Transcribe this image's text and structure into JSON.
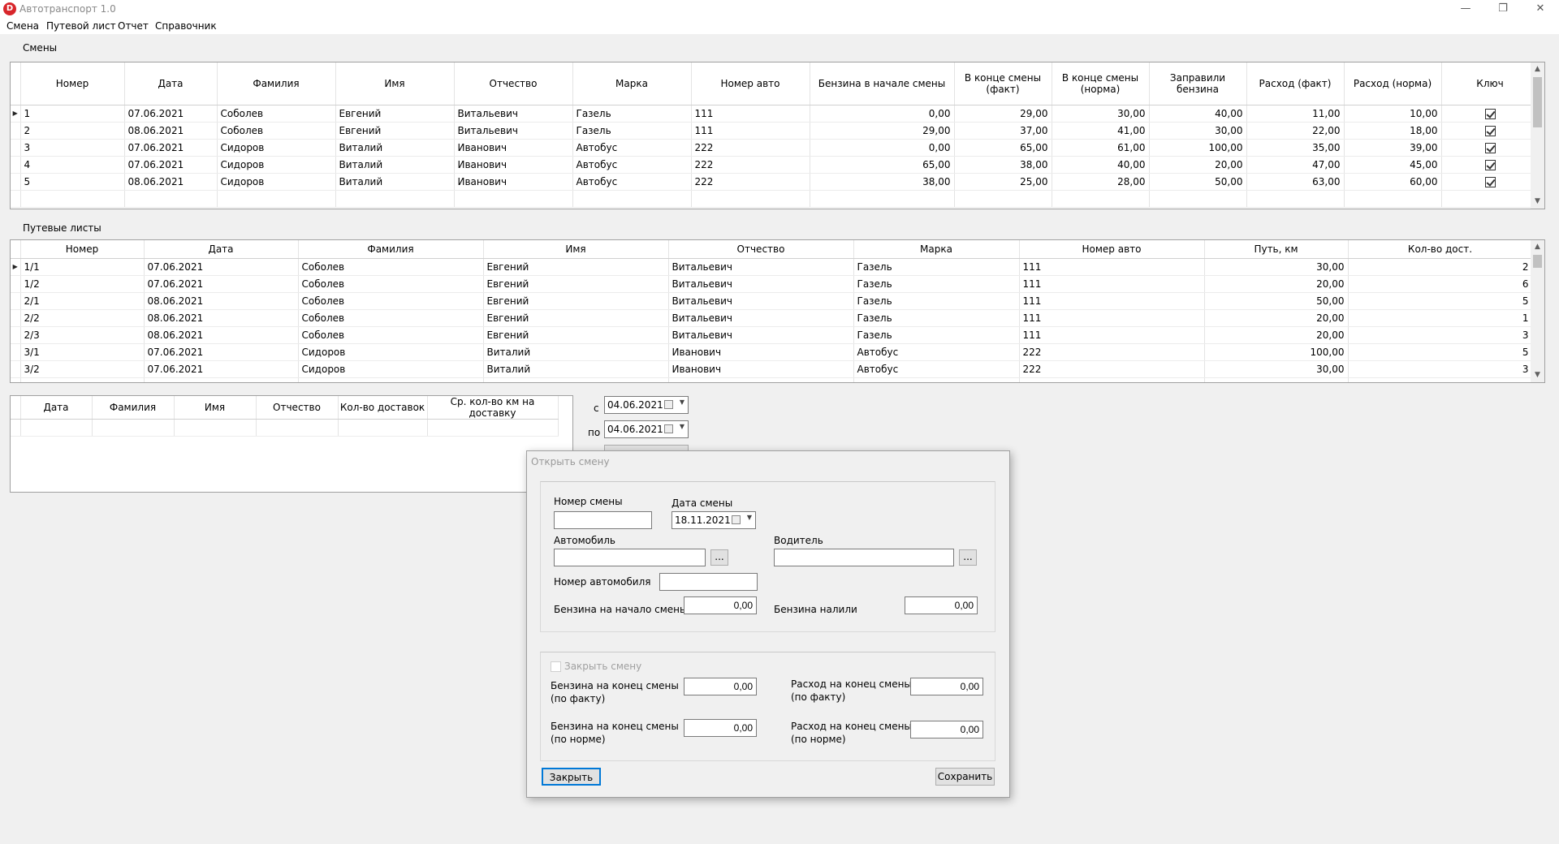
{
  "app": {
    "title": "Автотранспорт 1.0",
    "icon": "app-logo-icon"
  },
  "menu": [
    "Смена",
    "Путевой лист",
    "Отчет",
    "Справочник"
  ],
  "shifts": {
    "label": "Смены",
    "columns": [
      "Номер",
      "Дата",
      "Фамилия",
      "Имя",
      "Отчество",
      "Марка",
      "Номер авто",
      "Бензина в начале смены",
      "В конце смены (факт)",
      "В конце смены (норма)",
      "Заправили бензина",
      "Расход (факт)",
      "Расход (норма)",
      "Ключ"
    ],
    "rows": [
      [
        "1",
        "07.06.2021",
        "Соболев",
        "Евгений",
        "Витальевич",
        "Газель",
        "111",
        "0,00",
        "29,00",
        "30,00",
        "40,00",
        "11,00",
        "10,00"
      ],
      [
        "2",
        "08.06.2021",
        "Соболев",
        "Евгений",
        "Витальевич",
        "Газель",
        "111",
        "29,00",
        "37,00",
        "41,00",
        "30,00",
        "22,00",
        "18,00"
      ],
      [
        "3",
        "07.06.2021",
        "Сидоров",
        "Виталий",
        "Иванович",
        "Автобус",
        "222",
        "0,00",
        "65,00",
        "61,00",
        "100,00",
        "35,00",
        "39,00"
      ],
      [
        "4",
        "07.06.2021",
        "Сидоров",
        "Виталий",
        "Иванович",
        "Автобус",
        "222",
        "65,00",
        "38,00",
        "40,00",
        "20,00",
        "47,00",
        "45,00"
      ],
      [
        "5",
        "08.06.2021",
        "Сидоров",
        "Виталий",
        "Иванович",
        "Автобус",
        "222",
        "38,00",
        "25,00",
        "28,00",
        "50,00",
        "63,00",
        "60,00"
      ]
    ]
  },
  "waybills": {
    "label": "Путевые листы",
    "columns": [
      "Номер",
      "Дата",
      "Фамилия",
      "Имя",
      "Отчество",
      "Марка",
      "Номер авто",
      "Путь, км",
      "Кол-во дост."
    ],
    "rows": [
      [
        "1/1",
        "07.06.2021",
        "Соболев",
        "Евгений",
        "Витальевич",
        "Газель",
        "111",
        "30,00",
        "2"
      ],
      [
        "1/2",
        "07.06.2021",
        "Соболев",
        "Евгений",
        "Витальевич",
        "Газель",
        "111",
        "20,00",
        "6"
      ],
      [
        "2/1",
        "08.06.2021",
        "Соболев",
        "Евгений",
        "Витальевич",
        "Газель",
        "111",
        "50,00",
        "5"
      ],
      [
        "2/2",
        "08.06.2021",
        "Соболев",
        "Евгений",
        "Витальевич",
        "Газель",
        "111",
        "20,00",
        "1"
      ],
      [
        "2/3",
        "08.06.2021",
        "Соболев",
        "Евгений",
        "Витальевич",
        "Газель",
        "111",
        "20,00",
        "3"
      ],
      [
        "3/1",
        "07.06.2021",
        "Сидоров",
        "Виталий",
        "Иванович",
        "Автобус",
        "222",
        "100,00",
        "5"
      ],
      [
        "3/2",
        "07.06.2021",
        "Сидоров",
        "Виталий",
        "Иванович",
        "Автобус",
        "222",
        "30,00",
        "3"
      ]
    ]
  },
  "report": {
    "columns": [
      "Дата",
      "Фамилия",
      "Имя",
      "Отчество",
      "Кол-во доставок",
      "Ср. кол-во км на доставку"
    ],
    "from_label": "с",
    "from_date": "04.06.2021",
    "to_label": "по",
    "to_date": "04.06.2021"
  },
  "dialog": {
    "title": "Открыть смену",
    "shift_number_label": "Номер смены",
    "shift_number": "",
    "shift_date_label": "Дата смены",
    "shift_date": "18.11.2021",
    "car_label": "Автомобиль",
    "car": "",
    "driver_label": "Водитель",
    "driver": "",
    "browse_label": "...",
    "car_number_label": "Номер автомобиля",
    "car_number": "",
    "fuel_start_label": "Бензина на начало смены",
    "fuel_start": "0,00",
    "fuel_added_label": "Бензина налили",
    "fuel_added": "0,00",
    "close_shift_label": "Закрыть смену",
    "fuel_end_fact_label_1": "Бензина на конец смены",
    "fuel_end_fact_label_2": "(по факту)",
    "fuel_end_fact": "0,00",
    "consumption_fact_label_1": "Расход на конец смены",
    "consumption_fact_label_2": "(по факту)",
    "consumption_fact": "0,00",
    "fuel_end_norm_label_1": "Бензина на конец смены",
    "fuel_end_norm_label_2": "(по норме)",
    "fuel_end_norm": "0,00",
    "consumption_norm_label_1": "Расход на конец смены",
    "consumption_norm_label_2": "(по норме)",
    "consumption_norm": "0,00",
    "close_button": "Закрыть",
    "save_button": "Сохранить",
    "focus_color": "#0078d7"
  }
}
